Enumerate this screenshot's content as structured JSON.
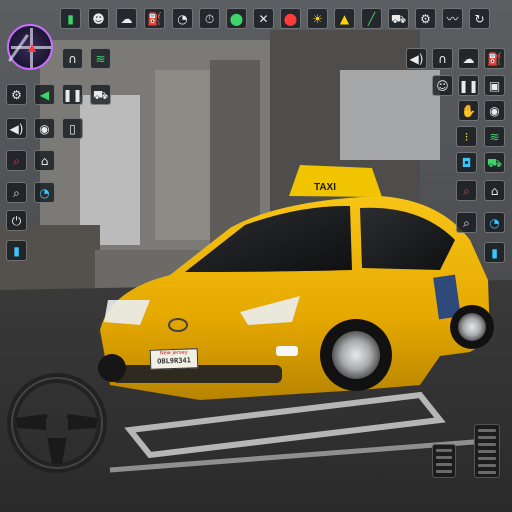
{
  "plate": {
    "state": "New Jersey",
    "number": "OBL9R341"
  },
  "taxi_sign": {
    "text": "TAXI"
  },
  "icons": {
    "top_row": [
      "microphone-icon",
      "driver-icon",
      "weather-icon",
      "fuel-icon",
      "speedometer-icon",
      "timer-icon",
      "location-icon",
      "tools-icon",
      "map-pin-icon",
      "light-icon",
      "warning-icon",
      "wrench-icon",
      "shopping-cart-icon",
      "engine-icon",
      "mustache-icon",
      "restart-icon"
    ],
    "left_col": [
      "headphones-icon",
      "wifi-icon",
      "settings-icon",
      "horn-icon",
      "pause-icon",
      "cart-icon",
      "volume-icon",
      "eye-icon",
      "phone-icon",
      "zoom-icon",
      "home-icon",
      "search-icon",
      "tachometer-icon",
      "plug-icon",
      "battery-icon"
    ],
    "right_col": [
      "volume-icon",
      "headphones-icon",
      "weather-icon",
      "fuel-icon",
      "chat-icon",
      "pause-icon",
      "camera-view-icon",
      "palm-icon",
      "traffic-light-icon",
      "wifi-icon",
      "camera-icon",
      "car-icon",
      "zoom-icon",
      "home-icon",
      "search-icon",
      "tachometer-icon",
      "battery-icon"
    ]
  },
  "colors": {
    "taxi": "#f2b500",
    "minimap_ring": "#c86cff",
    "accent_green": "#3ed46a",
    "accent_red": "#ff3b3b"
  }
}
